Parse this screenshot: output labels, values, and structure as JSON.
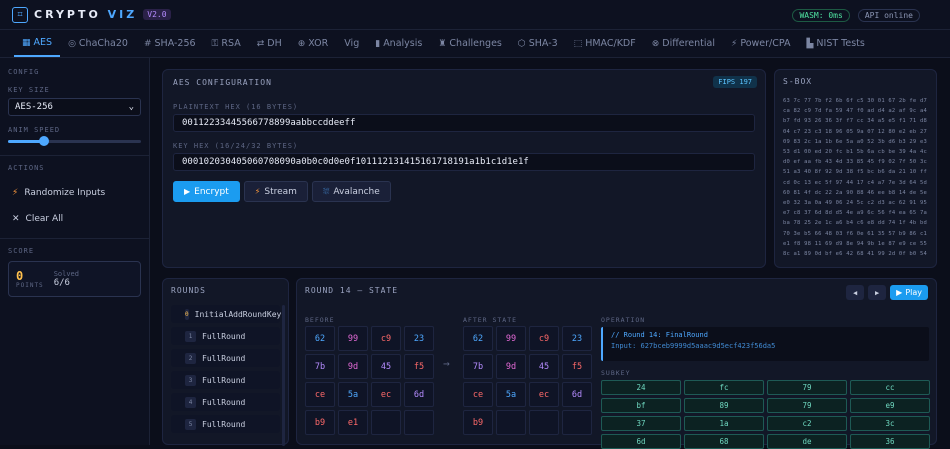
{
  "app": {
    "logo_glyph": "⌗",
    "name_a": "CRYPTO",
    "name_b": "VIZ",
    "version": "V2.0",
    "status_1": "WASM: 0ms",
    "status_2": "API online"
  },
  "tabs": [
    {
      "icon": "▦",
      "label": "AES"
    },
    {
      "icon": "◎",
      "label": "ChaCha20"
    },
    {
      "icon": "#",
      "label": "SHA-256"
    },
    {
      "icon": "⚿",
      "label": "RSA"
    },
    {
      "icon": "⇄",
      "label": "DH"
    },
    {
      "icon": "⊕",
      "label": "XOR"
    },
    {
      "icon": "",
      "label": "Vig"
    },
    {
      "icon": "▮",
      "label": "Analysis"
    },
    {
      "icon": "♜",
      "label": "Challenges"
    },
    {
      "icon": "⬡",
      "label": "SHA-3"
    },
    {
      "icon": "⬚",
      "label": "HMAC/KDF"
    },
    {
      "icon": "⊗",
      "label": "Differential"
    },
    {
      "icon": "⚡",
      "label": "Power/CPA"
    },
    {
      "icon": "▙",
      "label": "NIST Tests"
    }
  ],
  "sidebar": {
    "config": "CONFIG",
    "key_size_label": "KEY SIZE",
    "key_size_value": "AES-256",
    "anim_speed_label": "ANIM SPEED",
    "anim_speed": 0.27,
    "actions_label": "ACTIONS",
    "randomize_icon": "⚡",
    "randomize": "Randomize Inputs",
    "clear_icon": "✕",
    "clear": "Clear All",
    "score_label": "SCORE",
    "score": "0",
    "points": "POINTS",
    "solved_label": "Solved",
    "solved_value": "6/6"
  },
  "config_panel": {
    "title": "AES CONFIGURATION",
    "badge": "FIPS 197",
    "plaintext_label": "PLAINTEXT HEX (16 BYTES)",
    "plaintext": "00112233445566778899aabbccddeeff",
    "key_label": "KEY HEX (16/24/32 BYTES)",
    "key": "000102030405060708090a0b0c0d0e0f101112131415161718191a1b1c1d1e1f",
    "encrypt_icon": "▶",
    "encrypt": "Encrypt",
    "stream_icon": "⚡",
    "stream": "Stream",
    "avalanche_icon": "⛆",
    "avalanche": "Avalanche"
  },
  "sbox": {
    "title": "S-BOX",
    "rows": [
      "63 7c 77 7b f2 6b 6f c5 30 01 67 2b fe d7 ab 76",
      "ca 82 c9 7d fa 59 47 f0 ad d4 a2 af 9c a4 72 c0",
      "b7 fd 93 26 36 3f f7 cc 34 a5 e5 f1 71 d8 31 15",
      "04 c7 23 c3 18 96 05 9a 07 12 80 e2 eb 27 b2 75",
      "09 83 2c 1a 1b 6e 5a a0 52 3b d6 b3 29 e3 2f 84",
      "53 d1 00 ed 20 fc b1 5b 6a cb be 39 4a 4c 58 cf",
      "d0 ef aa fb 43 4d 33 85 45 f9 02 7f 50 3c 9f a8",
      "51 a3 40 8f 92 9d 38 f5 bc b6 da 21 10 ff f3 d2",
      "cd 0c 13 ec 5f 97 44 17 c4 a7 7e 3d 64 5d 19 73",
      "60 81 4f dc 22 2a 90 88 46 ee b8 14 de 5e 0b db",
      "e0 32 3a 0a 49 06 24 5c c2 d3 ac 62 91 95 e4 79",
      "e7 c8 37 6d 8d d5 4e a9 6c 56 f4 ea 65 7a ae 08",
      "ba 78 25 2e 1c a6 b4 c6 e8 dd 74 1f 4b bd 8b 8a",
      "70 3e b5 66 48 03 f6 0e 61 35 57 b9 86 c1 1d 9e",
      "e1 f8 98 11 69 d9 8e 94 9b 1e 87 e9 ce 55 28 df",
      "8c a1 89 0d bf e6 42 68 41 99 2d 0f b0 54 bb 16"
    ]
  },
  "rounds": {
    "title": "ROUNDS",
    "items": [
      {
        "n": "0",
        "label": "InitialAddRoundKey"
      },
      {
        "n": "1",
        "label": "FullRound"
      },
      {
        "n": "2",
        "label": "FullRound"
      },
      {
        "n": "3",
        "label": "FullRound"
      },
      {
        "n": "4",
        "label": "FullRound"
      },
      {
        "n": "5",
        "label": "FullRound"
      }
    ]
  },
  "state": {
    "title": "ROUND 14 — STATE",
    "prev_icon": "◀",
    "next_icon": "▶",
    "play_icon": "▶",
    "play": "Play",
    "before_label": "BEFORE",
    "after_label": "AFTER STATE",
    "arrow": "→",
    "before": [
      {
        "v": "62",
        "c": "#4ea8ff"
      },
      {
        "v": "99",
        "c": "#e36ad6"
      },
      {
        "v": "c9",
        "c": "#ff6a6a"
      },
      {
        "v": "23",
        "c": "#4ea8ff"
      },
      {
        "v": "7b",
        "c": "#b58cff"
      },
      {
        "v": "9d",
        "c": "#e36ad6"
      },
      {
        "v": "45",
        "c": "#b58cff"
      },
      {
        "v": "f5",
        "c": "#ff6a6a"
      },
      {
        "v": "ce",
        "c": "#ff6a6a"
      },
      {
        "v": "5a",
        "c": "#4ea8ff"
      },
      {
        "v": "ec",
        "c": "#ff6a6a"
      },
      {
        "v": "6d",
        "c": "#b58cff"
      },
      {
        "v": "b9",
        "c": "#ff6a6a"
      },
      {
        "v": "e1",
        "c": "#ff6a6a"
      },
      {
        "v": "",
        "c": "#c9cfe0"
      },
      {
        "v": "",
        "c": "#c9cfe0"
      }
    ],
    "after": [
      {
        "v": "62",
        "c": "#4ea8ff"
      },
      {
        "v": "99",
        "c": "#e36ad6"
      },
      {
        "v": "c9",
        "c": "#ff6a6a"
      },
      {
        "v": "23",
        "c": "#4ea8ff"
      },
      {
        "v": "7b",
        "c": "#b58cff"
      },
      {
        "v": "9d",
        "c": "#e36ad6"
      },
      {
        "v": "45",
        "c": "#b58cff"
      },
      {
        "v": "f5",
        "c": "#ff6a6a"
      },
      {
        "v": "ce",
        "c": "#ff6a6a"
      },
      {
        "v": "5a",
        "c": "#4ea8ff"
      },
      {
        "v": "ec",
        "c": "#ff6a6a"
      },
      {
        "v": "6d",
        "c": "#b58cff"
      },
      {
        "v": "b9",
        "c": "#ff6a6a"
      },
      {
        "v": "",
        "c": "#c9cfe0"
      },
      {
        "v": "",
        "c": "#c9cfe0"
      },
      {
        "v": "",
        "c": "#c9cfe0"
      }
    ],
    "operation_label": "OPERATION",
    "operation_line1": "// Round 14: FinalRound",
    "operation_line2": "Input: 627bceb9999d5aaac9d5ecf423f56da5",
    "subkey_label": "SUBKEY",
    "subkey": [
      "24",
      "fc",
      "79",
      "cc",
      "bf",
      "89",
      "79",
      "e9",
      "37",
      "1a",
      "c2",
      "3c",
      "6d",
      "68",
      "de",
      "36"
    ]
  }
}
